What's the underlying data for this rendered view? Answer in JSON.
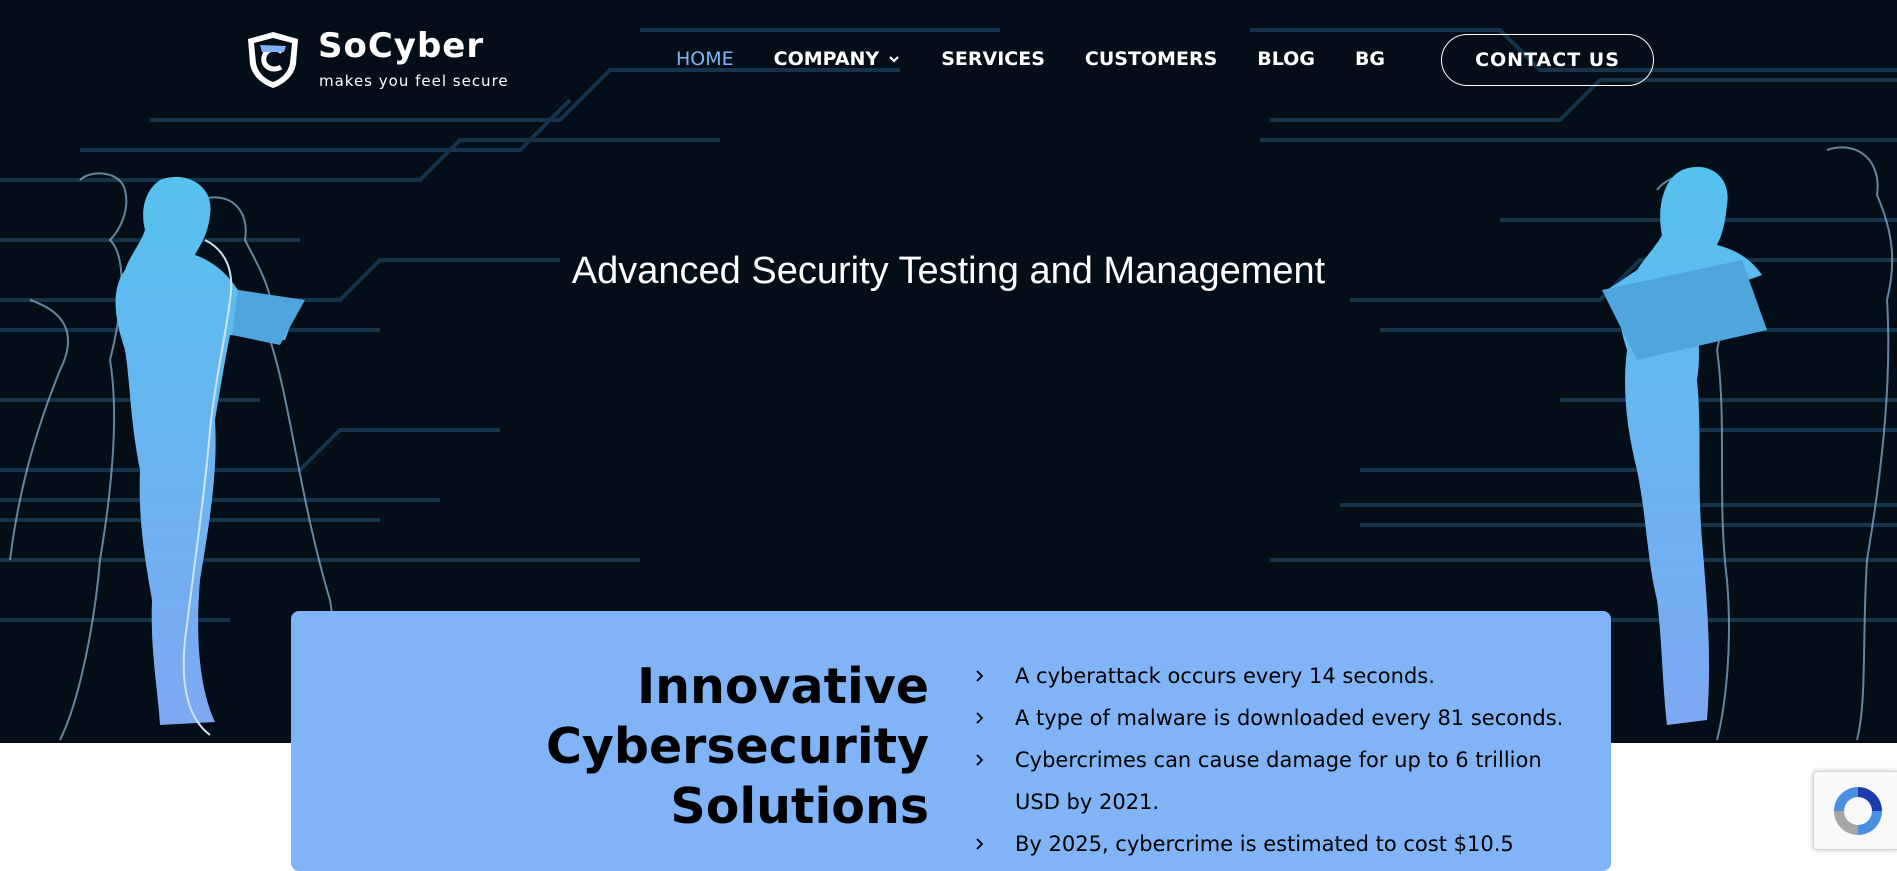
{
  "brand": {
    "name": "SoCyber",
    "tagline": "makes you feel secure"
  },
  "nav": {
    "items": [
      {
        "label": "HOME",
        "active": true
      },
      {
        "label": "COMPANY",
        "dropdown": true
      },
      {
        "label": "SERVICES"
      },
      {
        "label": "CUSTOMERS"
      },
      {
        "label": "BLOG"
      },
      {
        "label": "BG"
      }
    ],
    "contact_label": "CONTACT US"
  },
  "hero": {
    "title": "Advanced Security Testing and Management"
  },
  "intro": {
    "heading": "Innovative Cybersecurity Solutions",
    "facts": [
      "A cyberattack occurs every 14 seconds.",
      "A type of malware is downloaded every 81 seconds.",
      "Cybercrimes can cause damage for up to 6 trillion USD by 2021.",
      "By 2025, cybercrime is estimated to cost $10.5"
    ]
  },
  "colors": {
    "hero_bg": "#030e18",
    "accent": "#7fb3f5",
    "card_bg": "#80b4f7"
  },
  "icons": {
    "logo": "shield-logo-icon",
    "dropdown": "chevron-down-icon",
    "bullet": "chevron-right-icon",
    "recaptcha": "recaptcha-icon"
  }
}
